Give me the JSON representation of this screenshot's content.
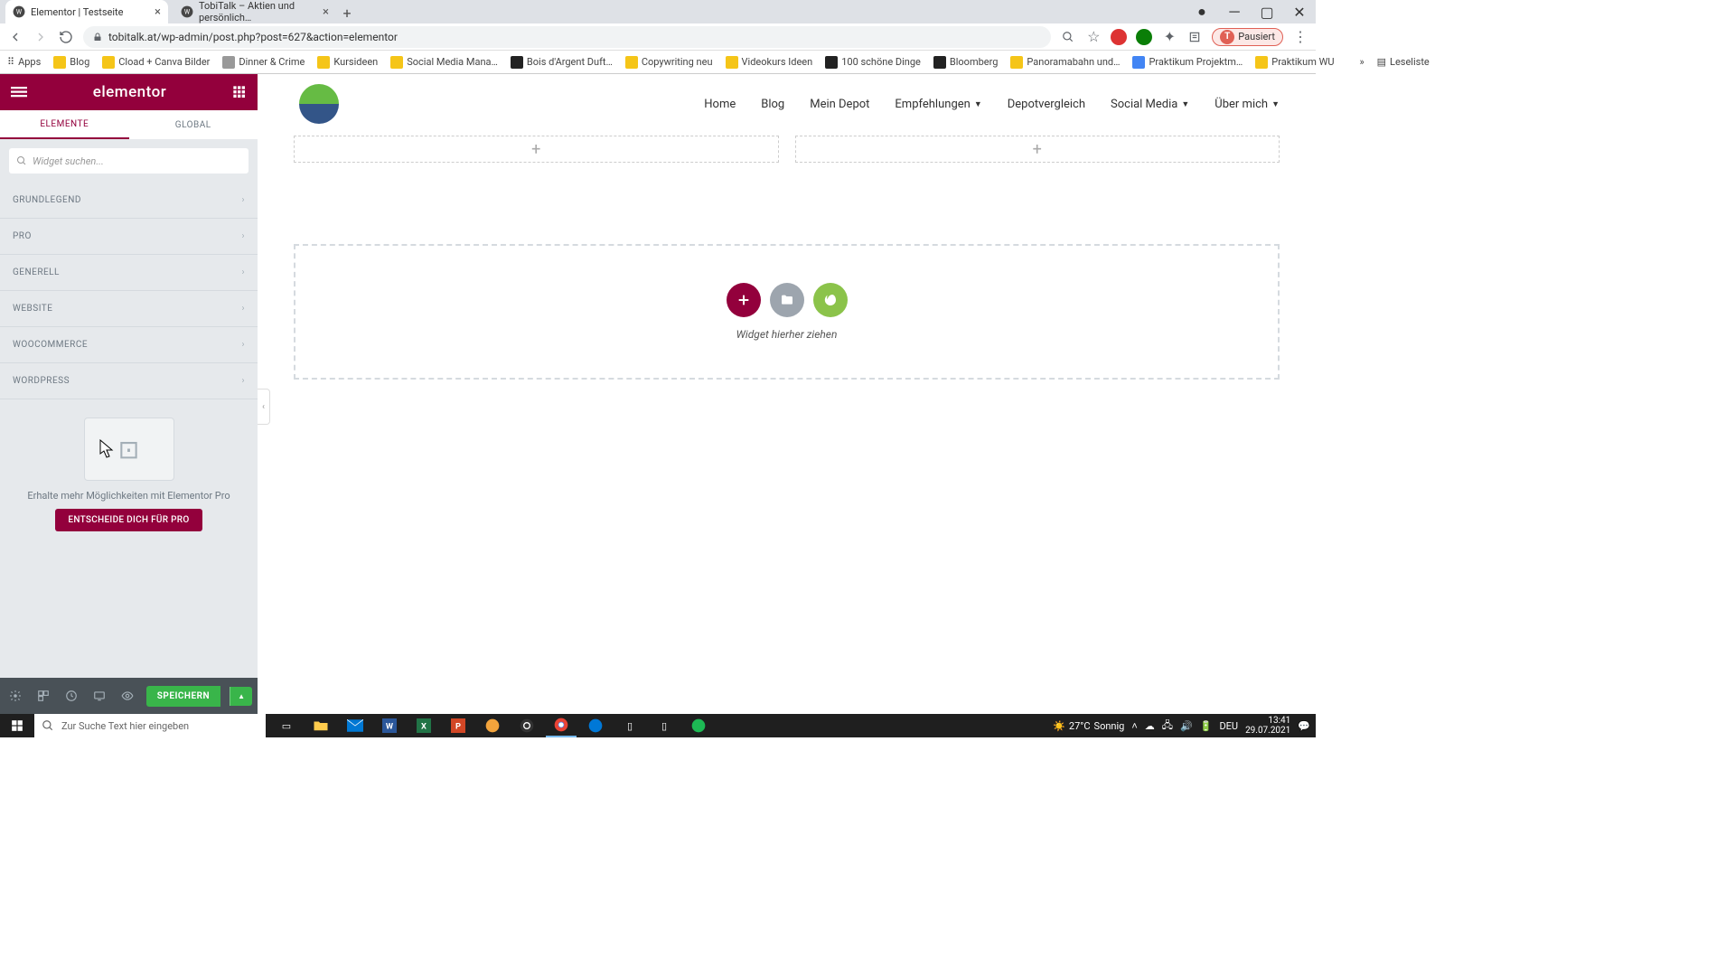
{
  "browser": {
    "tabs": [
      {
        "title": "Elementor | Testseite",
        "active": true
      },
      {
        "title": "TobiTalk – Aktien und persönlich…",
        "active": false
      }
    ],
    "url": "tobitalk.at/wp-admin/post.php?post=627&action=elementor",
    "pause_label": "Pausiert",
    "pause_initial": "T"
  },
  "bookmarks_prefix": "Apps",
  "bookmarks": [
    "Blog",
    "Cload + Canva Bilder",
    "Dinner & Crime",
    "Kursideen",
    "Social Media Mana…",
    "Bois d'Argent Duft…",
    "Copywriting neu",
    "Videokurs Ideen",
    "100 schöne Dinge",
    "Bloomberg",
    "Panoramabahn und…",
    "Praktikum Projektm…",
    "Praktikum WU"
  ],
  "bookmarks_more_label": "Leseliste",
  "panel": {
    "logo": "elementor",
    "tabs": {
      "elements": "ELEMENTE",
      "global": "GLOBAL"
    },
    "search_placeholder": "Widget suchen...",
    "categories": [
      "GRUNDLEGEND",
      "PRO",
      "GENERELL",
      "WEBSITE",
      "WOOCOMMERCE",
      "WORDPRESS"
    ],
    "promo_text": "Erhalte mehr Möglichkeiten mit Elementor Pro",
    "promo_cta": "ENTSCHEIDE DICH FÜR PRO",
    "save_label": "SPEICHERN"
  },
  "site_nav": [
    "Home",
    "Blog",
    "Mein Depot",
    "Empfehlungen",
    "Depotvergleich",
    "Social Media",
    "Über mich"
  ],
  "site_nav_dropdown_idx": [
    3,
    5,
    6
  ],
  "dropzone_text": "Widget hierher ziehen",
  "taskbar": {
    "search_placeholder": "Zur Suche Text hier eingeben",
    "weather_temp": "27°C",
    "weather_desc": "Sonnig",
    "lang": "DEU",
    "time": "13:41",
    "date": "29.07.2021"
  }
}
